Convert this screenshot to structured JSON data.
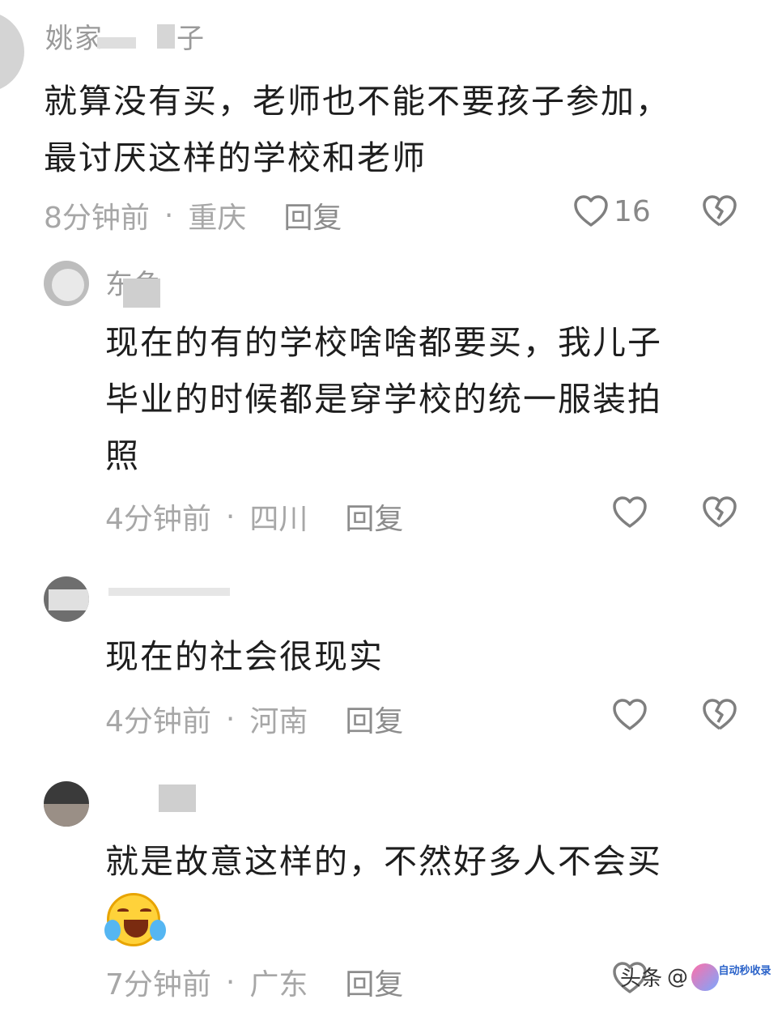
{
  "comments": [
    {
      "username": "姚家",
      "username_suffix": "子",
      "text_line1": "就算没有买，老师也不能不要孩子参加，",
      "text_line2": "最讨厌这样的学校和老师",
      "time": "8分钟前",
      "location": "重庆",
      "reply_label": "回复",
      "like_count": "16"
    },
    {
      "username": "东鱼",
      "text_line1": "现在的有的学校啥啥都要买，我儿子",
      "text_line2": "毕业的时候都是穿学校的统一服装拍",
      "text_line3": "照",
      "time": "4分钟前",
      "location": "四川",
      "reply_label": "回复"
    },
    {
      "username": "",
      "text_line1": "现在的社会很现实",
      "time": "4分钟前",
      "location": "河南",
      "reply_label": "回复"
    },
    {
      "username": "",
      "text_line1": "就是故意这样的，不然好多人不会买",
      "emoji": "laughing-crying-emoji",
      "time": "7分钟前",
      "location": "广东",
      "reply_label": "回复"
    }
  ],
  "separator": "·",
  "watermark": {
    "source": "头条",
    "at": "@",
    "badge": "自动秒收录"
  },
  "icons": {
    "like": "heart-outline-icon",
    "dislike": "broken-heart-icon"
  },
  "colors": {
    "text": "#1e1e1e",
    "meta": "#a7a7a7",
    "icon": "#7f7f7f"
  }
}
